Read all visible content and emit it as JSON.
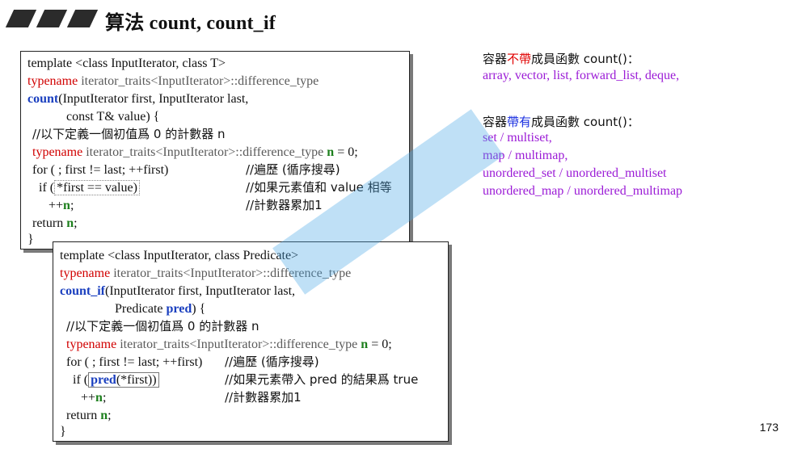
{
  "header": {
    "title": "算法 count, count_if"
  },
  "code1": {
    "lines": [
      "template <class InputIterator, class T>",
      "typename",
      " iterator_traits<InputIterator>::difference_type",
      "count",
      "(InputIterator first, InputIterator last,",
      "const T& value) {",
      "//以下定義一個初值爲 0 的計數器 n",
      "typename",
      " iterator_traits<InputIterator>::difference_type ",
      "n",
      " = 0;",
      "for ( ; first != last; ++first)",
      "//遍歷 (循序搜尋)",
      "if (",
      "*first == value)",
      "//如果元素值和 value 相等",
      "++",
      "n",
      ";",
      "//計數器累加1",
      "return ",
      "n",
      ";",
      "}"
    ]
  },
  "code2": {
    "lines": [
      "template <class InputIterator, class Predicate>",
      "typename",
      " iterator_traits<InputIterator>::difference_type",
      "count_if",
      "(InputIterator first, InputIterator last,",
      "Predicate ",
      "pred",
      ") {",
      "//以下定義一個初值爲 0 的計數器 n",
      "typename",
      " iterator_traits<InputIterator>::difference_type ",
      "n",
      " = 0;",
      "for ( ; first != last; ++first)",
      "//遍歷 (循序搜尋)",
      "if (",
      "pred",
      "(*first))",
      "//如果元素帶入 pred 的結果爲 true",
      "++",
      "n",
      ";",
      "//計數器累加1",
      "return ",
      "n",
      ";",
      "}"
    ]
  },
  "notes": {
    "without_prefix": "容器",
    "without_highlight": "不帶",
    "without_suffix": "成員函數 count()：",
    "without_list": "array, vector, list, forward_list, deque,",
    "with_prefix": "容器",
    "with_highlight": "帶有",
    "with_suffix": "成員函數 count()：",
    "with_list": [
      "set / multiset,",
      "map / multimap,",
      "unordered_set / unordered_multiset",
      "unordered_map / unordered_multimap"
    ]
  },
  "page": {
    "number": "173"
  },
  "colors": {
    "keyword_red": "#d10000",
    "func_blue": "#1a3fbf",
    "var_green": "#1d7f1d",
    "type_gray": "#5a5a5a",
    "list_purple": "#9b1bd6"
  }
}
